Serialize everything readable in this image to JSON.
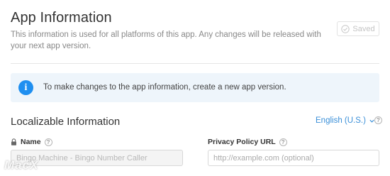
{
  "header": {
    "title": "App Information",
    "subtitle": "This information is used for all platforms of this app. Any changes will be released with your next app version.",
    "saved_label": "Saved"
  },
  "banner": {
    "icon": "info-icon",
    "text": "To make changes to the app information, create a new app version."
  },
  "section": {
    "title": "Localizable Information",
    "language": "English (U.S.)"
  },
  "fields": {
    "name": {
      "label": "Name",
      "value": "Bingo Machine - Bingo Number Caller",
      "help": "?"
    },
    "privacy": {
      "label": "Privacy Policy URL",
      "placeholder": "http://example.com (optional)",
      "help": "?"
    }
  },
  "watermark": "MacX",
  "colors": {
    "accent": "#1f8ff0",
    "link": "#3a8fd8",
    "banner_bg": "#eef5fb"
  }
}
